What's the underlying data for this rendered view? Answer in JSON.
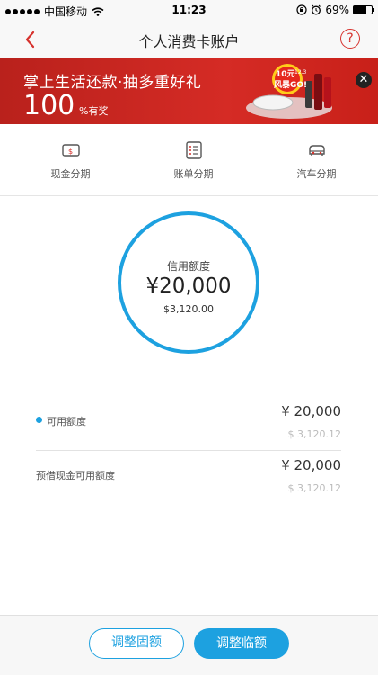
{
  "status_bar": {
    "carrier": "中国移动",
    "time": "11:23",
    "battery": "69%",
    "battery_level": 0.69,
    "icons": [
      "signal-dots",
      "wifi-icon",
      "rotation-lock-icon",
      "alarm-icon",
      "battery-icon"
    ]
  },
  "nav": {
    "title": "个人消费卡账户",
    "back_icon": "chevron-left-icon",
    "help_icon": "question-icon",
    "help_glyph": "?"
  },
  "banner": {
    "title": "掌上生活还款·抽多重好礼",
    "number": "100",
    "sub": "%有奖",
    "close_glyph": "✕",
    "art_icon": "promo-art",
    "art_text": "风暴GO!",
    "art_badge": "10元",
    "art_date": "12.3"
  },
  "quick_entries": [
    {
      "label": "现金分期",
      "icon": "cash-card-icon"
    },
    {
      "label": "账单分期",
      "icon": "bill-list-icon"
    },
    {
      "label": "汽车分期",
      "icon": "car-icon"
    }
  ],
  "credit": {
    "label": "信用额度",
    "amount": "¥20,000",
    "usd": "$3,120.00"
  },
  "details": [
    {
      "label": "可用额度",
      "value": "¥ 20,000",
      "sub": "$ 3,120.12"
    },
    {
      "label": "预借现金可用额度",
      "value": "¥ 20,000",
      "sub": "$ 3,120.12"
    }
  ],
  "buttons": {
    "fixed": "调整固额",
    "temp": "调整临额"
  },
  "colors": {
    "accent": "#1da1e0",
    "banner_red": "#d52b25",
    "nav_red": "#d6322d"
  }
}
